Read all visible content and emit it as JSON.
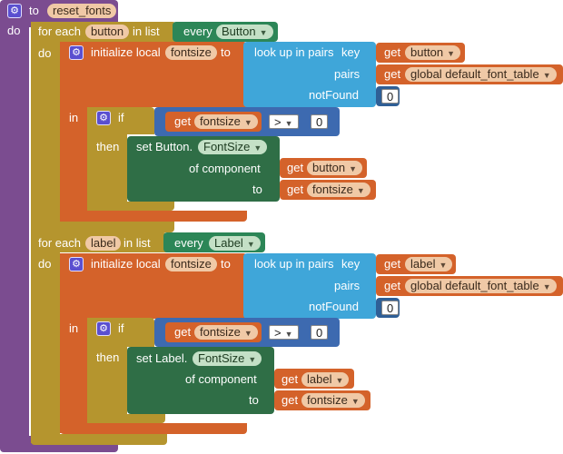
{
  "procedure": {
    "to": "to",
    "name": "reset_fonts",
    "do": "do"
  },
  "loop1": {
    "for_each": "for each",
    "var": "button",
    "in_list": "in list",
    "every": "every",
    "component_type": "Button",
    "do": "do",
    "init": {
      "label": "initialize local",
      "var": "fontsize",
      "to": "to",
      "lookup": "look up in pairs",
      "key": "key",
      "key_get": "get",
      "key_var": "button",
      "pairs": "pairs",
      "pairs_get": "get",
      "pairs_var": "global default_font_table",
      "not_found": "notFound",
      "not_found_value": "0"
    },
    "in": "in",
    "if": {
      "label": "if",
      "get": "get",
      "var": "fontsize",
      "op": ">",
      "value": "0"
    },
    "then": "then",
    "set": {
      "label": "set Button.",
      "prop": "FontSize",
      "of_component": "of component",
      "comp_get": "get",
      "comp_var": "button",
      "to": "to",
      "to_get": "get",
      "to_var": "fontsize"
    }
  },
  "loop2": {
    "for_each": "for each",
    "var": "label",
    "in_list": "in list",
    "every": "every",
    "component_type": "Label",
    "do": "do",
    "init": {
      "label": "initialize local",
      "var": "fontsize",
      "to": "to",
      "lookup": "look up in pairs",
      "key": "key",
      "key_get": "get",
      "key_var": "label",
      "pairs": "pairs",
      "pairs_get": "get",
      "pairs_var": "global default_font_table",
      "not_found": "notFound",
      "not_found_value": "0"
    },
    "in": "in",
    "if": {
      "label": "if",
      "get": "get",
      "var": "fontsize",
      "op": ">",
      "value": "0"
    },
    "then": "then",
    "set": {
      "label": "set Label.",
      "prop": "FontSize",
      "of_component": "of component",
      "comp_get": "get",
      "comp_var": "label",
      "to": "to",
      "to_get": "get",
      "to_var": "fontsize"
    }
  },
  "colors": {
    "procedure": "#7b4c90",
    "control": "#b5952e",
    "variables": "#d4622a",
    "lists": "#3fa6d9",
    "components": "#2f6e46",
    "math": "#2f5f96"
  }
}
